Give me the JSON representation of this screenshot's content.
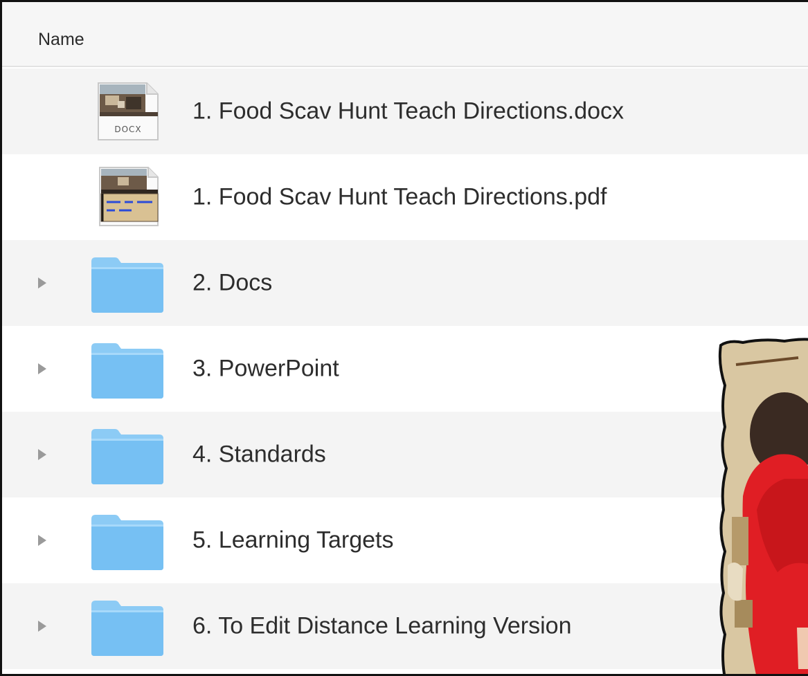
{
  "header": {
    "column_label": "Name"
  },
  "rows": [
    {
      "name": "1. Food Scav Hunt Teach Directions.docx",
      "kind": "docx",
      "icon": "docx-file-icon",
      "badge": "DOCX",
      "expandable": false
    },
    {
      "name": "1. Food Scav Hunt Teach Directions.pdf",
      "kind": "pdf",
      "icon": "pdf-file-icon",
      "expandable": false
    },
    {
      "name": "2. Docs",
      "kind": "folder",
      "icon": "folder-icon",
      "expandable": true
    },
    {
      "name": "3. PowerPoint",
      "kind": "folder",
      "icon": "folder-icon",
      "expandable": true
    },
    {
      "name": "4. Standards",
      "kind": "folder",
      "icon": "folder-icon",
      "expandable": true
    },
    {
      "name": "5. Learning Targets",
      "kind": "folder",
      "icon": "folder-icon",
      "expandable": true
    },
    {
      "name": "6. To Edit Distance Learning Version",
      "kind": "folder",
      "icon": "folder-icon",
      "expandable": true
    }
  ],
  "colors": {
    "folder": "#7cc4f4",
    "folder_tab": "#9fd6fa",
    "row_alt": "#f4f4f4",
    "disclosure": "#9a9a9a"
  },
  "overlay": {
    "icon": "painting-photo"
  }
}
